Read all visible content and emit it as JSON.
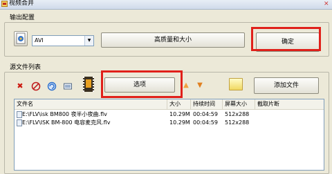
{
  "window": {
    "title": "视频合并"
  },
  "output_group": {
    "label": "输出配置",
    "format": {
      "selected": "AVI",
      "icon": "format-icon"
    },
    "quality_size_button": "高质量和大小",
    "confirm_button": "确定"
  },
  "source_group": {
    "label": "源文件列表",
    "toolbar": {
      "options_button": "选项",
      "add_file_button": "添加文件",
      "icons": [
        "delete-icon",
        "clear-icon",
        "refresh-icon",
        "screen-icon",
        "film-icon",
        "move-up-icon",
        "move-down-icon",
        "folder-icon"
      ]
    },
    "columns": [
      "文件名",
      "大小",
      "持续时间",
      "屏幕大小",
      "截取片断"
    ],
    "files": [
      {
        "name": "E:\\FLV\\isk BM800 夜半小夜曲.flv",
        "size": "10.29M",
        "duration": "00:04:59",
        "resolution": "512x288",
        "clip": ""
      },
      {
        "name": "E:\\FLV\\ISK BM-800 电容麦克风.flv",
        "size": "10.29M",
        "duration": "00:04:59",
        "resolution": "512x288",
        "clip": ""
      }
    ]
  },
  "highlight_color": "#e0201a"
}
